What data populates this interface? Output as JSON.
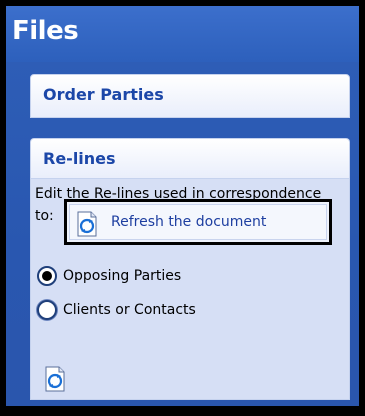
{
  "pane": {
    "title": "Files"
  },
  "order_parties": {
    "title": "Order Parties"
  },
  "relines": {
    "title": "Re-lines",
    "description": "Edit the Re-lines used in correspondence to:",
    "options": [
      {
        "label": "Opposing Parties",
        "selected": true
      },
      {
        "label": "Clients or Contacts",
        "selected": false
      }
    ],
    "refresh_label": "Refresh the document"
  },
  "icons": {
    "refresh": "refresh-document-icon"
  },
  "colors": {
    "pane_background": "#2957b0",
    "header_text": "#ffffff",
    "section_title": "#1c47a8",
    "section_body": "#d6dff5",
    "link_text": "#1d3ea0"
  }
}
